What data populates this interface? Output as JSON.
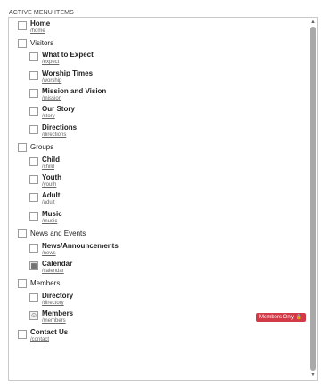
{
  "heading": "ACTIVE MENU ITEMS",
  "items": [
    {
      "title": "Home",
      "slug": "/home"
    },
    {
      "title": "Visitors"
    },
    {
      "title": "What to Expect",
      "slug": "/expect"
    },
    {
      "title": "Worship Times",
      "slug": "/worship"
    },
    {
      "title": "Mission and Vision",
      "slug": "/mission"
    },
    {
      "title": "Our Story",
      "slug": "/story"
    },
    {
      "title": "Directions",
      "slug": "/directions"
    },
    {
      "title": "Groups"
    },
    {
      "title": "Child",
      "slug": "/child"
    },
    {
      "title": "Youth",
      "slug": "/youth"
    },
    {
      "title": "Adult",
      "slug": "/adult"
    },
    {
      "title": "Music",
      "slug": "/music"
    },
    {
      "title": "News and Events"
    },
    {
      "title": "News/Announcements",
      "slug": "/news"
    },
    {
      "title": "Calendar",
      "slug": "/calendar",
      "icon": "calendar-icon"
    },
    {
      "title": "Members"
    },
    {
      "title": "Directory",
      "slug": "/directory"
    },
    {
      "title": "Members",
      "slug": "/members",
      "icon": "user-icon"
    },
    {
      "title": "Contact Us",
      "slug": "/contact"
    }
  ],
  "badge": {
    "label": "Members Only",
    "icon": "lock-icon",
    "color": "#d33a48"
  }
}
